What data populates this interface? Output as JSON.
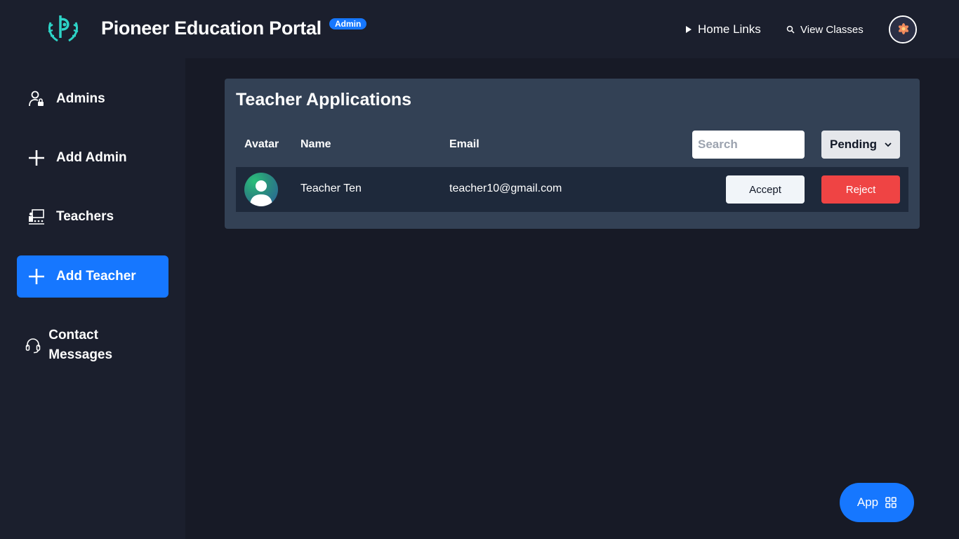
{
  "header": {
    "brand": "Pioneer Education Portal",
    "role_badge": "Admin",
    "nav": [
      {
        "label": "Home Links",
        "icon": "play-triangle-icon"
      },
      {
        "label": "View Classes",
        "icon": "search-icon"
      }
    ],
    "avatar_icon": "user-avatar-flower-icon"
  },
  "sidebar": {
    "items": [
      {
        "label": "Admins",
        "icon": "user-lock-icon",
        "active": false
      },
      {
        "label": "Add Admin",
        "icon": "plus-icon",
        "active": false
      },
      {
        "label": "Teachers",
        "icon": "teacher-board-icon",
        "active": false
      },
      {
        "label": "Add Teacher",
        "icon": "plus-icon",
        "active": true
      },
      {
        "label": "Contact Messages",
        "icon": "headset-icon",
        "active": false
      }
    ]
  },
  "main": {
    "title": "Teacher Applications",
    "columns": [
      "Avatar",
      "Name",
      "Email"
    ],
    "search_placeholder": "Search",
    "status_filter": {
      "selected": "Pending"
    },
    "rows": [
      {
        "name": "Teacher Ten",
        "email": "teacher10@gmail.com",
        "accept_label": "Accept",
        "reject_label": "Reject"
      }
    ]
  },
  "app_button": {
    "label": "App",
    "icon": "grid-icon"
  },
  "colors": {
    "accent": "#1677ff",
    "reject": "#ef4444",
    "background": "#171a26",
    "panel": "#1b1f2d",
    "card": "#334155",
    "row": "#1e293b"
  }
}
